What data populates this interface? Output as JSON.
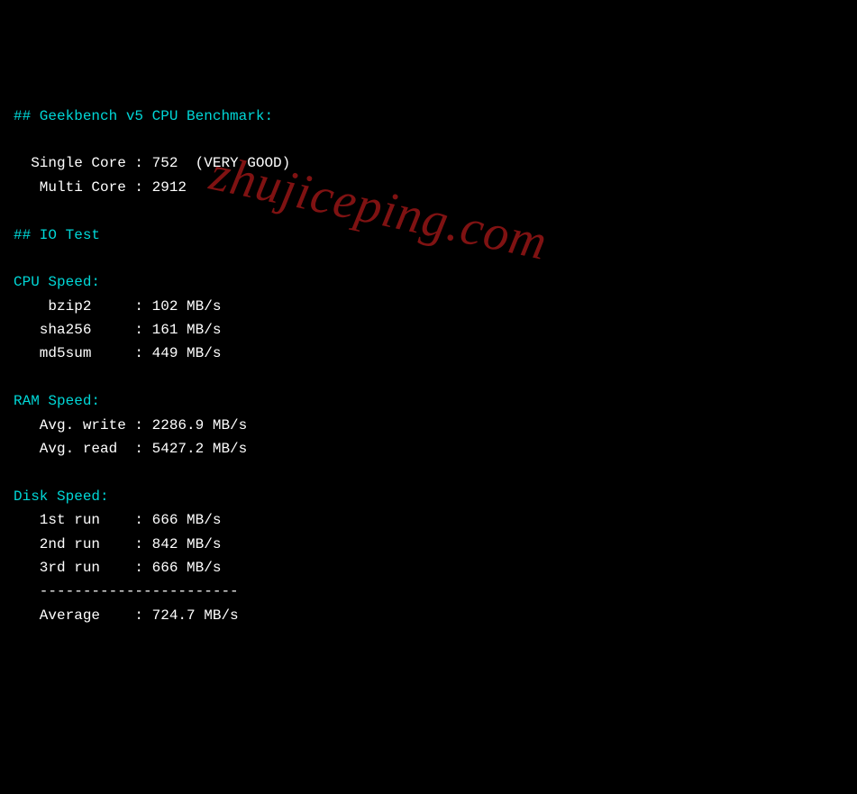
{
  "watermark": "zhujiceping.com",
  "geekbench": {
    "header": "## Geekbench v5 CPU Benchmark:",
    "single_label": "  Single Core : ",
    "single_value": "752  (VERY GOOD)",
    "multi_label": "   Multi Core : ",
    "multi_value": "2912"
  },
  "iotest_header": "## IO Test",
  "cpu": {
    "header": "CPU Speed:",
    "bzip2_label": "    bzip2     : ",
    "bzip2_value": "102 MB/s",
    "sha256_label": "   sha256     : ",
    "sha256_value": "161 MB/s",
    "md5sum_label": "   md5sum     : ",
    "md5sum_value": "449 MB/s"
  },
  "ram": {
    "header": "RAM Speed:",
    "write_label": "   Avg. write : ",
    "write_value": "2286.9 MB/s",
    "read_label": "   Avg. read  : ",
    "read_value": "5427.2 MB/s"
  },
  "disk": {
    "header": "Disk Speed:",
    "run1_label": "   1st run    : ",
    "run1_value": "666 MB/s",
    "run2_label": "   2nd run    : ",
    "run2_value": "842 MB/s",
    "run3_label": "   3rd run    : ",
    "run3_value": "666 MB/s",
    "divider": "   -----------------------",
    "avg_label": "   Average    : ",
    "avg_value": "724.7 MB/s"
  }
}
